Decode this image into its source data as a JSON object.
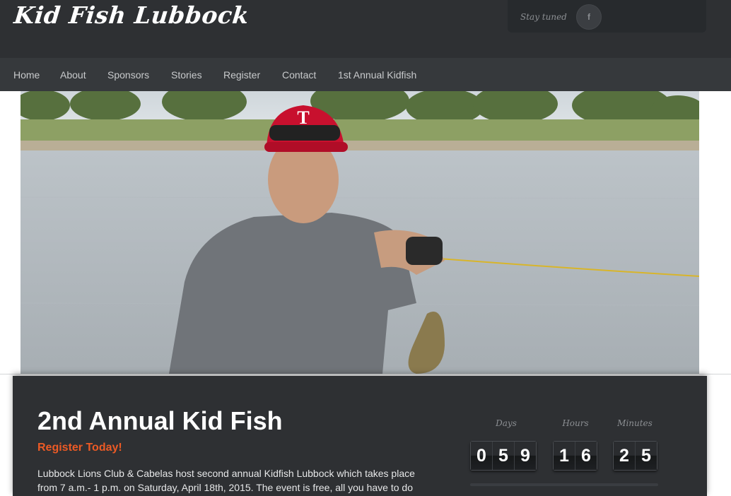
{
  "header": {
    "logo": "Kid Fish Lubbock",
    "social": {
      "label": "Stay tuned",
      "facebook_icon": "f"
    }
  },
  "nav": {
    "items": [
      {
        "label": "Home"
      },
      {
        "label": "About"
      },
      {
        "label": "Sponsors"
      },
      {
        "label": "Stories"
      },
      {
        "label": "Register"
      },
      {
        "label": "Contact"
      },
      {
        "label": "1st Annual Kidfish"
      }
    ]
  },
  "hero": {
    "image_subject": "teen in red cap and gray shirt holding up a caught fish by a lake",
    "cap_letter": "T"
  },
  "main": {
    "title": "2nd Annual Kid Fish",
    "subtitle": "Register Today!",
    "body": "Lubbock Lions Club & Cabelas host second annual Kidfish Lubbock which takes place from 7 a.m.- 1 p.m. on Saturday, April 18th, 2015. The event is free, all you have to do"
  },
  "countdown": {
    "labels": {
      "days": "Days",
      "hours": "Hours",
      "minutes": "Minutes"
    },
    "days": [
      "0",
      "5",
      "9"
    ],
    "hours": [
      "1",
      "6"
    ],
    "minutes": [
      "2",
      "5"
    ]
  },
  "colors": {
    "header_bg": "#2e3033",
    "nav_bg": "#36393c",
    "accent": "#ec5a25"
  }
}
